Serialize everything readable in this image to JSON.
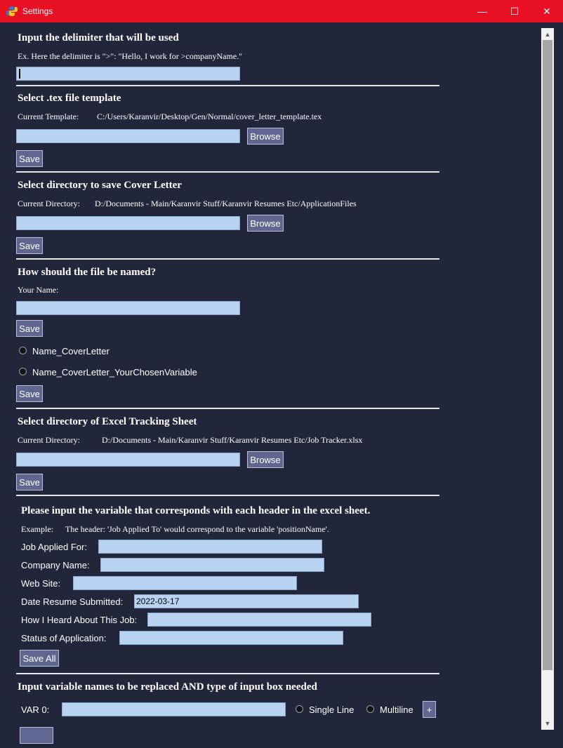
{
  "window": {
    "title": "Settings",
    "minimize_glyph": "—",
    "maximize_glyph": "☐",
    "close_glyph": "✕",
    "icon": "python-icon"
  },
  "delimiter": {
    "heading": "Input the delimiter that will be used",
    "example": "Ex. Here the delimiter is \">\":   \"Hello, I work for >companyName.\"",
    "value": ""
  },
  "template": {
    "heading": "Select .tex file template",
    "current_label": "Current Template:",
    "current_value": "C:/Users/Karanvir/Desktop/Gen/Normal/cover_letter_template.tex",
    "value": "",
    "browse_label": "Browse",
    "save_label": "Save"
  },
  "save_dir": {
    "heading": "Select directory to save Cover Letter",
    "current_label": "Current Directory:",
    "current_value": "D:/Documents - Main/Karanvir Stuff/Karanvir Resumes Etc/ApplicationFiles",
    "value": "",
    "browse_label": "Browse",
    "save_label": "Save"
  },
  "naming": {
    "heading": "How should the file be named?",
    "name_label": "Your Name:",
    "value": "",
    "save_label": "Save",
    "options": [
      "Name_CoverLetter",
      "Name_CoverLetter_YourChosenVariable"
    ],
    "save2_label": "Save"
  },
  "excel": {
    "heading": "Select directory of Excel Tracking Sheet",
    "current_label": "Current Directory:",
    "current_value": "D:/Documents - Main/Karanvir Stuff/Karanvir Resumes Etc/Job Tracker.xlsx",
    "value": "",
    "browse_label": "Browse",
    "save_label": "Save"
  },
  "headers": {
    "heading": "Please input the variable that corresponds with each header in the excel sheet.",
    "example_label": "Example:",
    "example_text": "The header: 'Job Applied To' would correspond to the variable 'positionName'.",
    "fields": [
      {
        "label": "Job Applied For:",
        "value": ""
      },
      {
        "label": "Company Name:",
        "value": ""
      },
      {
        "label": "Web Site:",
        "value": ""
      },
      {
        "label": "Date Resume Submitted:",
        "value": "2022-03-17"
      },
      {
        "label": "How I Heard About This Job:",
        "value": ""
      },
      {
        "label": "Status of Application:",
        "value": ""
      }
    ],
    "save_all_label": "Save All"
  },
  "variables": {
    "heading": "Input variable names to be replaced AND type of input box needed",
    "var_label": "VAR 0:",
    "value": "",
    "single_label": "Single Line",
    "multi_label": "Multiline",
    "add_label": "+"
  },
  "scrollbar": {
    "up_glyph": "▲",
    "down_glyph": "▼"
  }
}
